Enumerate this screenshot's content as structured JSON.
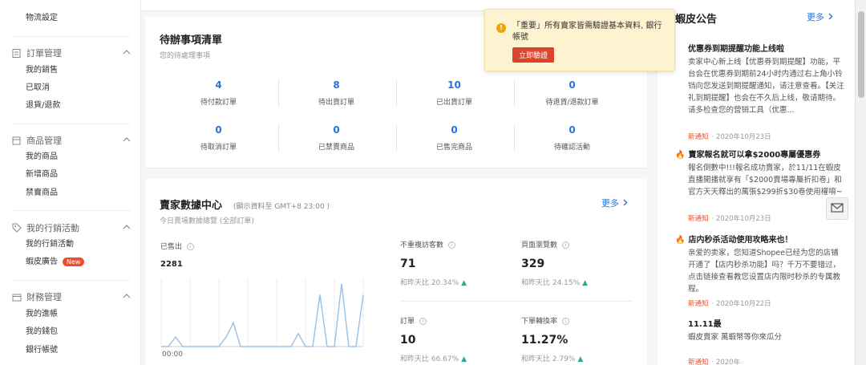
{
  "sidebar": {
    "top_item": "物流設定",
    "groups": [
      {
        "title": "訂單管理",
        "icon": "clipboard-icon",
        "items": [
          "我的銷售",
          "已取消",
          "退貨/退款"
        ]
      },
      {
        "title": "商品管理",
        "icon": "box-icon",
        "items": [
          "我的商品",
          "新增商品",
          "禁賣商品"
        ]
      },
      {
        "title": "我的行銷活動",
        "icon": "tag-icon",
        "items": [
          "我的行銷活動",
          "蝦皮廣告"
        ],
        "badge": "New"
      },
      {
        "title": "財務管理",
        "icon": "wallet-icon",
        "items": [
          "我的進帳",
          "我的錢包",
          "銀行帳號"
        ]
      }
    ]
  },
  "todo": {
    "title": "待辦事項清單",
    "subtitle": "您的待處理事項",
    "cells": [
      {
        "value": "4",
        "label": "待付款訂單"
      },
      {
        "value": "8",
        "label": "待出貨訂單"
      },
      {
        "value": "10",
        "label": "已出貨訂單"
      },
      {
        "value": "0",
        "label": "待退貨/退款訂單"
      },
      {
        "value": "0",
        "label": "待取消訂單"
      },
      {
        "value": "0",
        "label": "已禁賣商品"
      },
      {
        "value": "0",
        "label": "已售完商品"
      },
      {
        "value": "0",
        "label": "待確認活動"
      }
    ]
  },
  "data_center": {
    "title": "賣家數據中心",
    "note": "(顯示資料至 GMT+8 23:00 )",
    "subtitle": "今日賣場數據總覽 (全部訂單)",
    "more": "更多",
    "sales_label": "已售出",
    "sales_value": "2281",
    "x_start": "00:00",
    "metrics": [
      {
        "label": "不重複訪客數",
        "value": "71",
        "compare": "和昨天比 20.34%"
      },
      {
        "label": "頁面瀏覽數",
        "value": "329",
        "compare": "和昨天比 24.15%"
      },
      {
        "label": "訂單",
        "value": "10",
        "compare": "和昨天比 66.67%"
      },
      {
        "label": "下單轉換率",
        "value": "11.27%",
        "compare": "和昨天比 2.79%"
      }
    ]
  },
  "chart_data": {
    "type": "line",
    "values": [
      0,
      0,
      0.14,
      0,
      0,
      0,
      0,
      0,
      0,
      0.14,
      0.35,
      0,
      0,
      0,
      0,
      0,
      0,
      0,
      0,
      0.19,
      0,
      0,
      0.76,
      0,
      0,
      0.92,
      0,
      0,
      0.76
    ],
    "color": "#9ec3e6"
  },
  "announcements": {
    "title": "蝦皮公告",
    "more": "更多",
    "items": [
      {
        "title": "优惠券到期提醒功能上线啦",
        "body": "卖家中心新上线【优惠券到期提醒】功能，平台会在优惠券到期前24小时内通过右上角小铃铛向您发送到期提醒通知，请注意查看。【关注礼到期提醒】也会在不久后上线，敬请期待。请多检查您的营销工具（优惠...",
        "tag": "新通知",
        "date": "2020年10月23日"
      },
      {
        "title": "賣家報名就可以拿$2000專屬優惠券",
        "body": "報名倒數中!!!報名成功賣家，於11/11在蝦皮直播開播就享有「$2000賣場專屬折扣卷」和官方天天釋出的萬張$299折$30卷使用權唷~",
        "tag": "新通知",
        "date": "2020年10月23日"
      },
      {
        "title": "店内秒杀活动使用攻略来也！",
        "body": "亲爱的卖家，您知道Shopee已经为您的店铺开通了【店内秒杀功能】吗？千万不要错过，点击链接查看教您设置店内限时秒杀的专属教程。",
        "tag": "新通知",
        "date": "2020年10月22日"
      },
      {
        "title": "11.11最",
        "body": "蝦皮賣家 萬蝦幣等你來瓜分",
        "tag": "新通知",
        "date": "2020年"
      }
    ]
  },
  "notice": {
    "text": "「重要」所有賣家皆需驗證基本資料, 銀行帳號",
    "button": "立即驗證"
  }
}
